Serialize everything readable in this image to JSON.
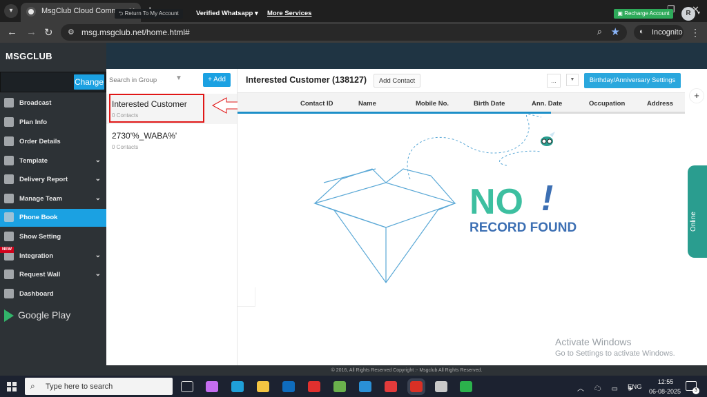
{
  "browser": {
    "tab_title": "MsgClub Cloud Communication",
    "url": "msg.msgclub.net/home.html#",
    "incognito_label": "Incognito"
  },
  "header": {
    "brand": "MSGCLUB",
    "return_label": "Return To My Account",
    "verified_whatsapp": "Verified Whatsapp",
    "more_services": "More Services",
    "recharge_label": "Recharge Account",
    "avatar_initial": "R"
  },
  "sidebar": {
    "change_label": "Change",
    "new_badge": "NEW",
    "items": [
      {
        "label": "Broadcast",
        "icon": "broadcast-icon",
        "has_chevron": false
      },
      {
        "label": "Plan Info",
        "icon": "plan-info-icon",
        "has_chevron": false
      },
      {
        "label": "Order Details",
        "icon": "order-details-icon",
        "has_chevron": false
      },
      {
        "label": "Template",
        "icon": "template-icon",
        "has_chevron": true
      },
      {
        "label": "Delivery Report",
        "icon": "delivery-report-icon",
        "has_chevron": true
      },
      {
        "label": "Manage Team",
        "icon": "manage-team-icon",
        "has_chevron": true
      },
      {
        "label": "Phone Book",
        "icon": "phone-book-icon",
        "has_chevron": false,
        "active": true
      },
      {
        "label": "Show Setting",
        "icon": "show-setting-icon",
        "has_chevron": false
      },
      {
        "label": "Integration",
        "icon": "integration-icon",
        "has_chevron": true
      },
      {
        "label": "Request Wall",
        "icon": "request-wall-icon",
        "has_chevron": true
      },
      {
        "label": "Dashboard",
        "icon": "dashboard-icon",
        "has_chevron": false
      }
    ],
    "google_play": "Google Play"
  },
  "groups": {
    "search_placeholder": "Search in Group",
    "add_label": "+ Add",
    "items": [
      {
        "name": "Interested Customer",
        "count": "0 Contacts"
      },
      {
        "name": "2730'%_WABA%'",
        "count": "0 Contacts"
      }
    ]
  },
  "main": {
    "group_title": "Interested Customer (138127)",
    "add_contact_label": "Add Contact",
    "more_label": "...",
    "birthday_label": "Birthday/Anniversary Settings",
    "columns": [
      "Contact ID",
      "Name",
      "Mobile No.",
      "Birth Date",
      "Ann. Date",
      "Occupation",
      "Address"
    ],
    "empty_state": {
      "line1": "NO",
      "exclaim": "!",
      "line2": "RECORD FOUND"
    }
  },
  "online_label": "Online",
  "watermark": {
    "title": "Activate Windows",
    "subtitle": "Go to Settings to activate Windows."
  },
  "footer": "© 2016, All Rights Reserved Copyright :- Msgclub All Rights Reserved.",
  "taskbar": {
    "search_placeholder": "Type here to search",
    "lang": "ENG",
    "time": "12:55",
    "date": "06-08-2025",
    "notification_count": "3"
  },
  "colors": {
    "accent_blue": "#1ba1e2",
    "sidebar_bg": "#2d3236",
    "empty_teal": "#3dbfa0",
    "empty_blue": "#3c6fb3"
  }
}
